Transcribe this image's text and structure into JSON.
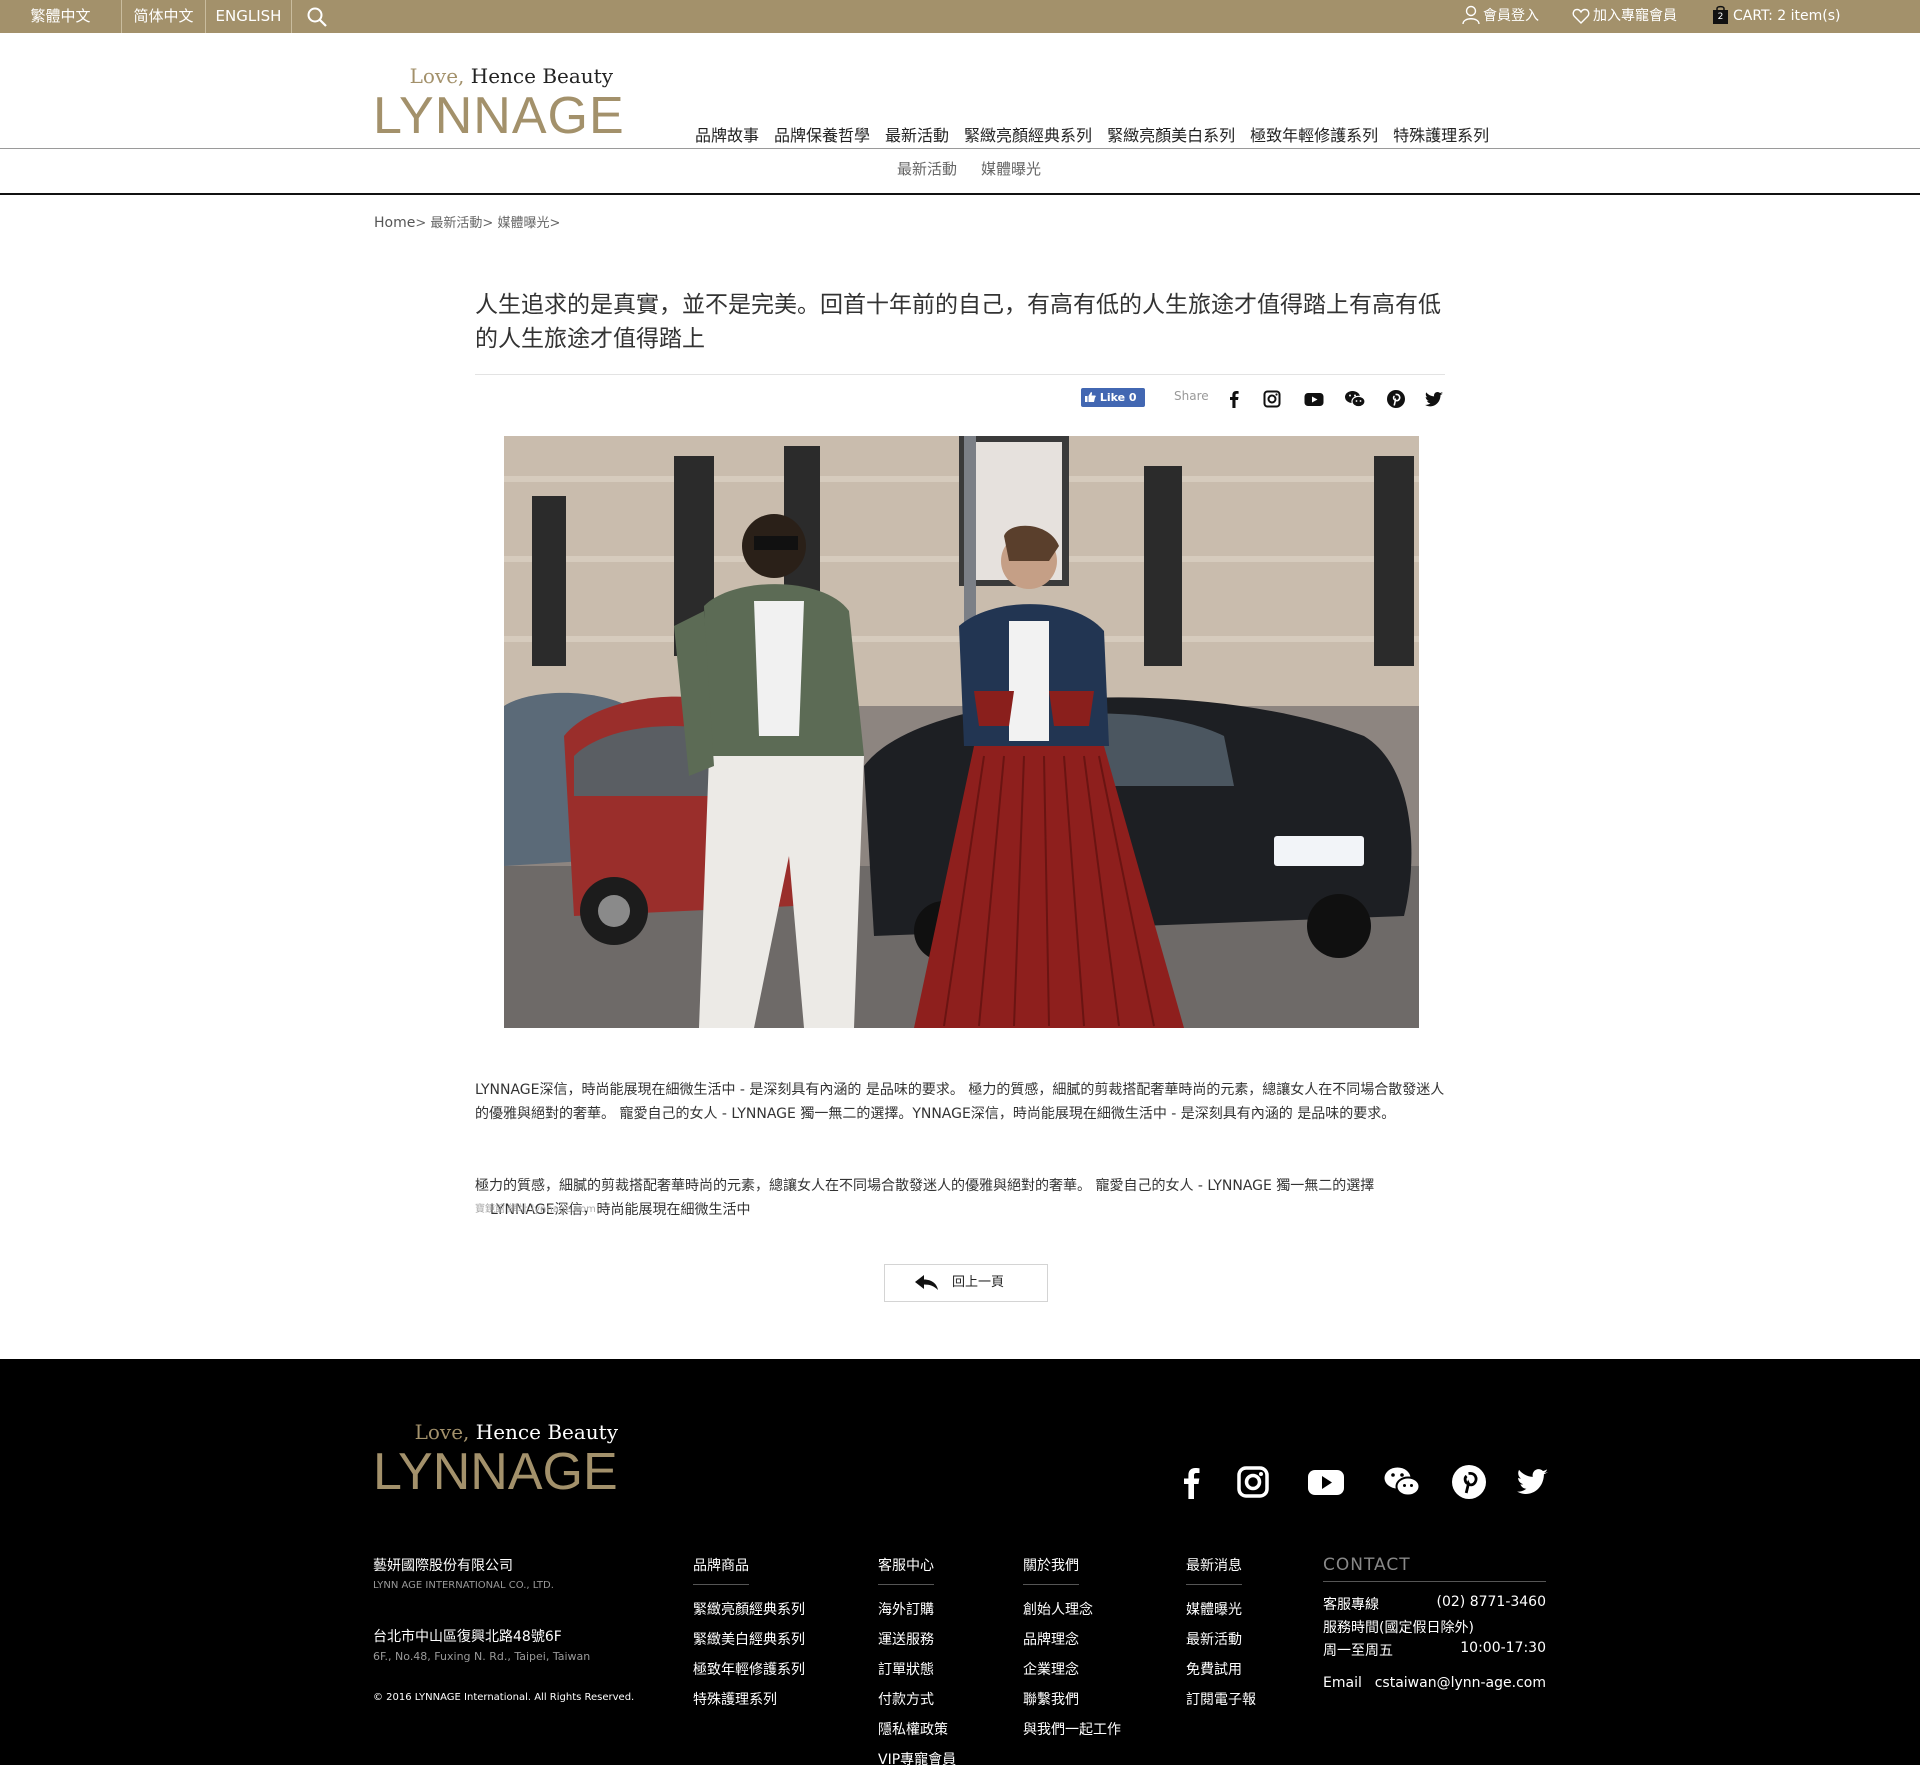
{
  "topbar": {
    "languages": [
      "繁體中文",
      "简体中文",
      "ENGLISH"
    ],
    "login": "會員登入",
    "vip": "加入專寵會員",
    "cart_count": "2",
    "cart": "CART: 2 item(s)"
  },
  "header": {
    "tagline_love": "Love,",
    "tagline_rest": " Hence Beauty",
    "brand": "LYNNAGE",
    "nav": [
      "品牌故事",
      "品牌保養哲學",
      "最新活動",
      "緊緻亮顏經典系列",
      "緊緻亮顏美白系列",
      "極致年輕修護系列",
      "特殊護理系列"
    ],
    "subnav": [
      "最新活動",
      "媒體曝光"
    ]
  },
  "breadcrumb": {
    "home": "Home",
    "sep": ">",
    "items": [
      "最新活動",
      "媒體曝光"
    ]
  },
  "article": {
    "title": "人生追求的是真實，並不是完美。回首十年前的自己，有高有低的人生旅途才值得踏上有高有低的人生旅途才值得踏上",
    "fb_like": "Like 0",
    "share_label": "Share",
    "paragraph1": "LYNNAGE深信，時尚能展現在細微生活中 - 是深刻具有內涵的 是品味的要求。 極力的質感，細膩的剪裁搭配奢華時尚的元素，總讓女人在不同場合散發迷人的優雅與絕對的奢華。 寵愛自己的女人 - LYNNAGE 獨一無二的選擇。YNNAGE深信，時尚能展現在細微生活中 - 是深刻具有內涵的 是品味的要求。",
    "paragraph2": "極力的質感，細膩的剪裁搭配奢華時尚的元素，總讓女人在不同場合散發迷人的優雅與絕對的奢華。 寵愛自己的女人 - LYNNAGE 獨一無二的選擇",
    "paragraph2_tail": "LYNNAGE深信，時尚能展現在細微生活中",
    "ghost_text": "寶鏡館 網址 lynnage.com",
    "back_button": "回上一頁"
  },
  "footer": {
    "tagline_love": "Love,",
    "tagline_rest": " Hence Beauty",
    "brand": "LYNNAGE",
    "company": "藝妍國際股份有限公司",
    "company_en": "LYNN AGE INTERNATIONAL CO., LTD.",
    "address": "台北市中山區復興北路48號6F",
    "address_en": "6F., No.48, Fuxing N. Rd., Taipei, Taiwan",
    "copyright": "© 2016 LYNNAGE International. All Rights Reserved.",
    "columns": [
      {
        "title": "品牌商品",
        "items": [
          "緊緻亮顏經典系列",
          "緊緻美白經典系列",
          "極致年輕修護系列",
          "特殊護理系列"
        ]
      },
      {
        "title": "客服中心",
        "items": [
          "海外訂購",
          "運送服務",
          "訂單狀態",
          "付款方式",
          "隱私權政策",
          "VIP專寵會員"
        ]
      },
      {
        "title": "關於我們",
        "items": [
          "創始人理念",
          "品牌理念",
          "企業理念",
          "聯繫我們",
          "與我們一起工作"
        ]
      },
      {
        "title": "最新消息",
        "items": [
          "媒體曝光",
          "最新活動",
          "免費試用",
          "訂閱電子報"
        ]
      }
    ],
    "contact": {
      "title": "CONTACT",
      "hotline_label": "客服專線",
      "hotline": "(02) 8771-3460",
      "hours_label": "服務時間(國定假日除外)",
      "days": "周一至周五",
      "time": "10:00-17:30",
      "email_label": "Email",
      "email": "cstaiwan@lynn-age.com"
    }
  },
  "colors": {
    "gold": "#a3916b",
    "footer_bg": "#000000",
    "facebook": "#4267b2"
  }
}
